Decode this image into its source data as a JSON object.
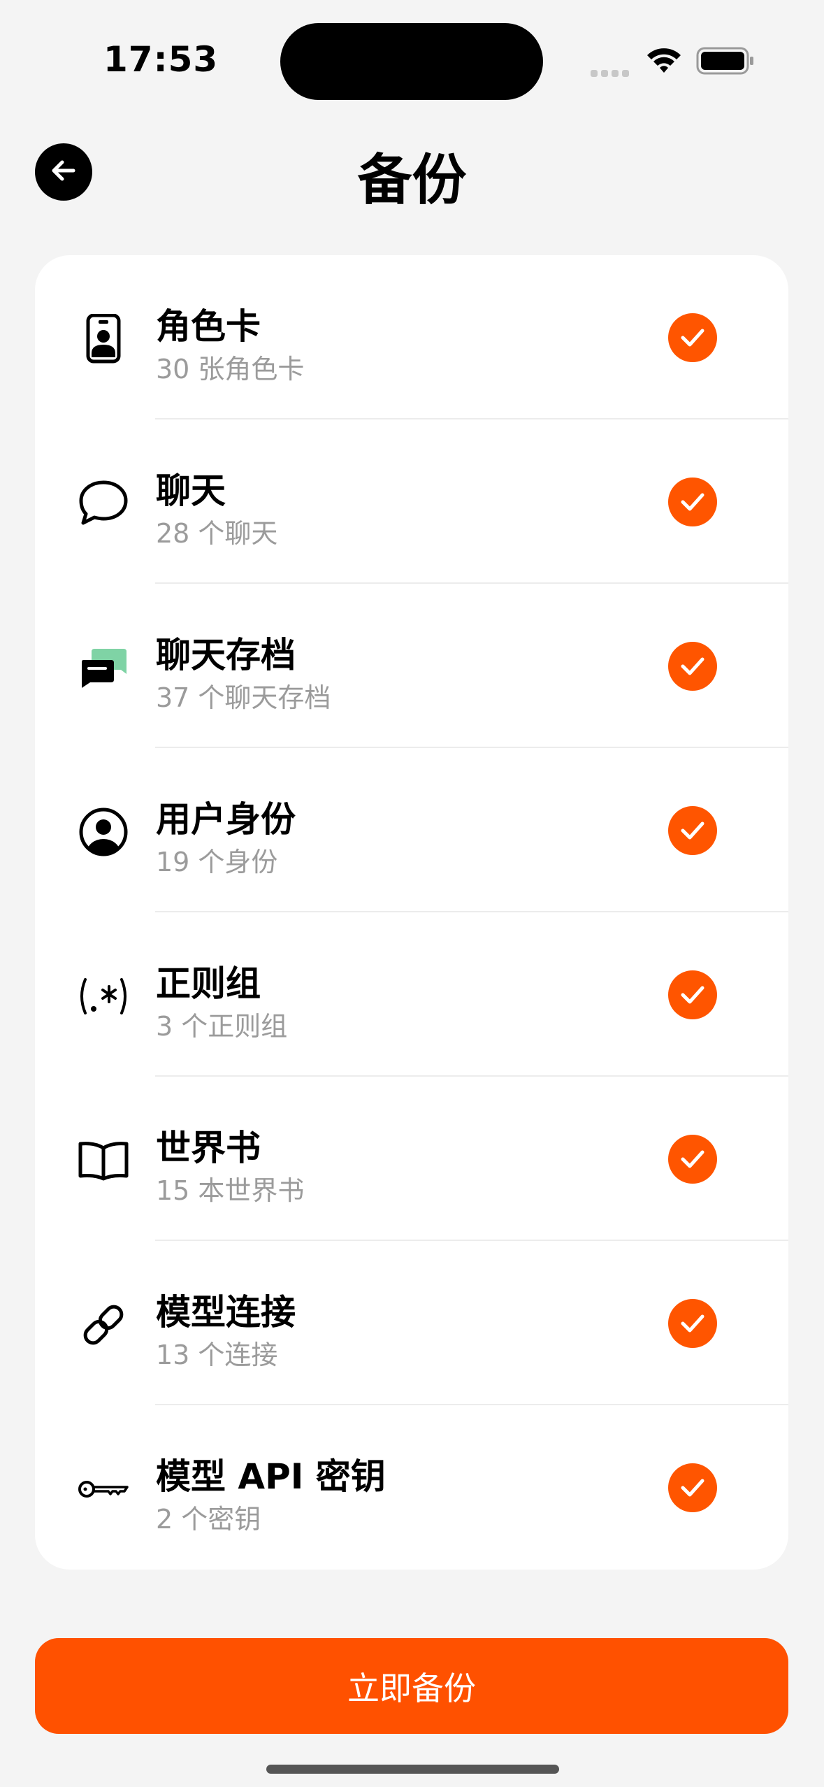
{
  "status_bar": {
    "time": "17:53"
  },
  "header": {
    "title": "备份",
    "back_icon": "arrow-left-icon"
  },
  "items": [
    {
      "title": "角色卡",
      "subtitle": "30 张角色卡",
      "icon": "id-badge-icon",
      "checked": true
    },
    {
      "title": "聊天",
      "subtitle": "28 个聊天",
      "icon": "chat-bubble-icon",
      "checked": true
    },
    {
      "title": "聊天存档",
      "subtitle": "37 个聊天存档",
      "icon": "chat-archive-icon",
      "checked": true
    },
    {
      "title": "用户身份",
      "subtitle": "19 个身份",
      "icon": "user-circle-icon",
      "checked": true
    },
    {
      "title": "正则组",
      "subtitle": "3 个正则组",
      "icon": "regex-icon",
      "checked": true
    },
    {
      "title": "世界书",
      "subtitle": "15 本世界书",
      "icon": "book-icon",
      "checked": true
    },
    {
      "title": "模型连接",
      "subtitle": "13 个连接",
      "icon": "link-icon",
      "checked": true
    },
    {
      "title": "模型 API 密钥",
      "subtitle": "2 个密钥",
      "icon": "key-icon",
      "checked": true
    }
  ],
  "action": {
    "label": "立即备份"
  },
  "colors": {
    "accent": "#ff5500",
    "background": "#f4f4f4",
    "card": "#ffffff",
    "subtitle": "#9b9b9b"
  }
}
